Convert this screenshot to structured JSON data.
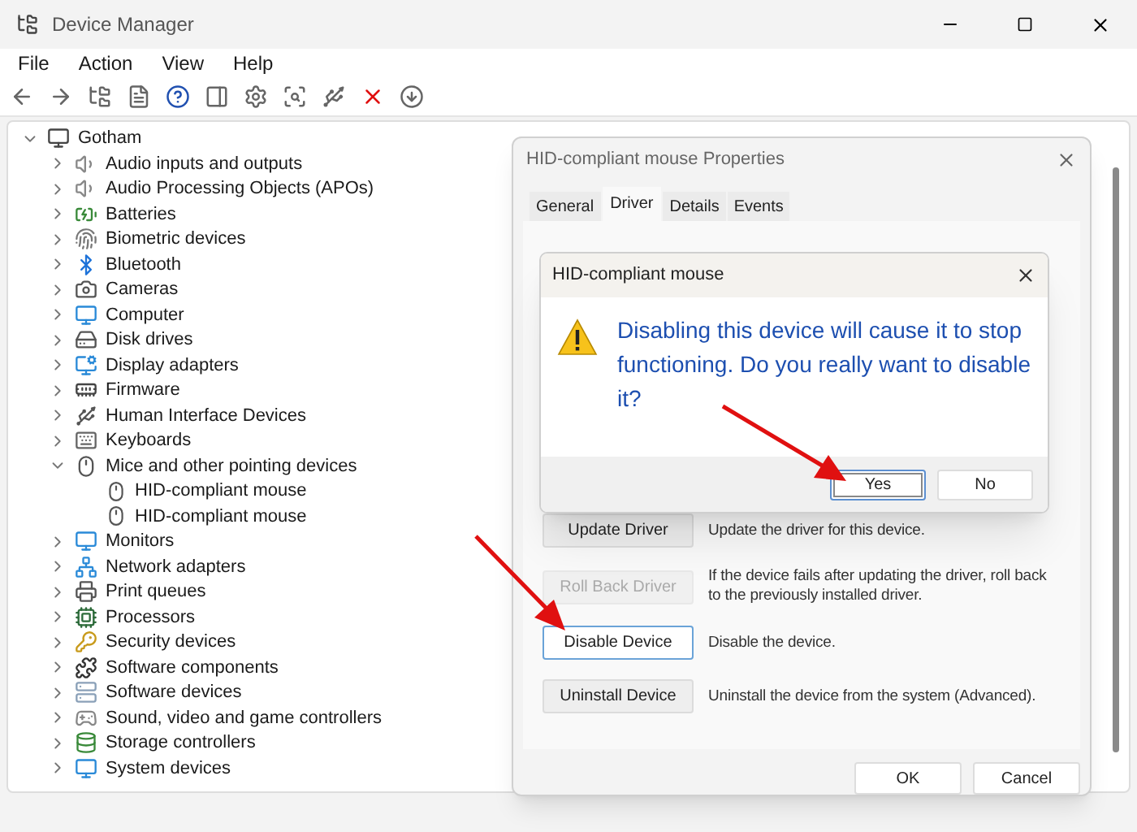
{
  "window": {
    "title": "Device Manager"
  },
  "menu": [
    "File",
    "Action",
    "View",
    "Help"
  ],
  "tree": {
    "name": "Gotham",
    "expanded": true,
    "children": [
      {
        "name": "Audio inputs and outputs",
        "expanded": false
      },
      {
        "name": "Audio Processing Objects (APOs)",
        "expanded": false
      },
      {
        "name": "Batteries",
        "expanded": false
      },
      {
        "name": "Biometric devices",
        "expanded": false
      },
      {
        "name": "Bluetooth",
        "expanded": false
      },
      {
        "name": "Cameras",
        "expanded": false
      },
      {
        "name": "Computer",
        "expanded": false
      },
      {
        "name": "Disk drives",
        "expanded": false
      },
      {
        "name": "Display adapters",
        "expanded": false
      },
      {
        "name": "Firmware",
        "expanded": false
      },
      {
        "name": "Human Interface Devices",
        "expanded": false
      },
      {
        "name": "Keyboards",
        "expanded": false
      },
      {
        "name": "Mice and other pointing devices",
        "expanded": true,
        "children": [
          {
            "name": "HID-compliant mouse"
          },
          {
            "name": "HID-compliant mouse"
          }
        ]
      },
      {
        "name": "Monitors",
        "expanded": false
      },
      {
        "name": "Network adapters",
        "expanded": false
      },
      {
        "name": "Print queues",
        "expanded": false
      },
      {
        "name": "Processors",
        "expanded": false
      },
      {
        "name": "Security devices",
        "expanded": false
      },
      {
        "name": "Software components",
        "expanded": false
      },
      {
        "name": "Software devices",
        "expanded": false
      },
      {
        "name": "Sound, video and game controllers",
        "expanded": false
      },
      {
        "name": "Storage controllers",
        "expanded": false
      },
      {
        "name": "System devices",
        "expanded": false
      }
    ]
  },
  "properties": {
    "title": "HID-compliant mouse Properties",
    "tabs": [
      {
        "label": "General",
        "selected": false
      },
      {
        "label": "Driver",
        "selected": true
      },
      {
        "label": "Details",
        "selected": false
      },
      {
        "label": "Events",
        "selected": false
      }
    ],
    "actions": [
      {
        "button": "Update Driver",
        "description": "Update the driver for this device.",
        "disabled": false,
        "focused": false
      },
      {
        "button": "Roll Back Driver",
        "description": "If the device fails after updating the driver, roll back to the previously installed driver.",
        "disabled": true,
        "focused": false
      },
      {
        "button": "Disable Device",
        "description": "Disable the device.",
        "disabled": false,
        "focused": true
      },
      {
        "button": "Uninstall Device",
        "description": "Uninstall the device from the system (Advanced).",
        "disabled": false,
        "focused": false
      }
    ],
    "buttons": [
      "OK",
      "Cancel"
    ]
  },
  "confirm": {
    "title": "HID-compliant mouse",
    "message": "Disabling this device will cause it to stop functioning. Do you really want to disable it?",
    "buttons": [
      {
        "label": "Yes",
        "focused": true
      },
      {
        "label": "No",
        "focused": false
      }
    ]
  }
}
